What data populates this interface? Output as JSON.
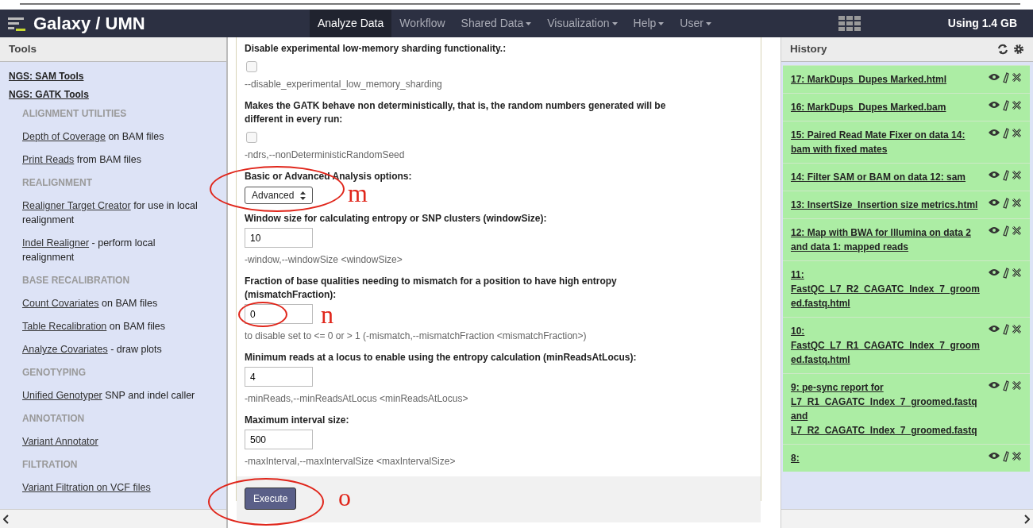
{
  "navbar": {
    "brand": "Galaxy / UMN",
    "tabs": [
      {
        "label": "Analyze Data",
        "selected": true,
        "dropdown": false
      },
      {
        "label": "Workflow",
        "selected": false,
        "dropdown": false
      },
      {
        "label": "Shared Data",
        "selected": false,
        "dropdown": true
      },
      {
        "label": "Visualization",
        "selected": false,
        "dropdown": true
      },
      {
        "label": "Help",
        "selected": false,
        "dropdown": true
      },
      {
        "label": "User",
        "selected": false,
        "dropdown": true
      }
    ],
    "usage": "Using 1.4 GB"
  },
  "tools": {
    "title": "Tools",
    "items": [
      {
        "kind": "category",
        "text": "NGS: SAM Tools"
      },
      {
        "kind": "category",
        "text": "NGS: GATK Tools"
      },
      {
        "kind": "section",
        "text": "ALIGNMENT UTILITIES"
      },
      {
        "kind": "tool",
        "link": "Depth of Coverage",
        "rest": "on BAM files"
      },
      {
        "kind": "tool",
        "link": "Print Reads",
        "rest": "from BAM files"
      },
      {
        "kind": "section",
        "text": "REALIGNMENT"
      },
      {
        "kind": "tool",
        "link": "Realigner Target Creator",
        "rest": "for use in local realignment"
      },
      {
        "kind": "tool",
        "link": "Indel Realigner",
        "rest": "- perform local realignment"
      },
      {
        "kind": "section",
        "text": "BASE RECALIBRATION"
      },
      {
        "kind": "tool",
        "link": "Count Covariates",
        "rest": "on BAM files"
      },
      {
        "kind": "tool",
        "link": "Table Recalibration",
        "rest": "on BAM files"
      },
      {
        "kind": "tool",
        "link": "Analyze Covariates",
        "rest": "- draw plots"
      },
      {
        "kind": "section",
        "text": "GENOTYPING"
      },
      {
        "kind": "tool",
        "link": "Unified Genotyper",
        "rest": "SNP and indel caller"
      },
      {
        "kind": "section",
        "text": "ANNOTATION"
      },
      {
        "kind": "tool",
        "link": "Variant Annotator"
      },
      {
        "kind": "section",
        "text": "FILTRATION"
      },
      {
        "kind": "tool",
        "link": "Variant Filtration on VCF files"
      }
    ]
  },
  "form": {
    "params": [
      {
        "kind": "checkbox",
        "label": "Disable experimental low-memory sharding functionality.:",
        "checked": false,
        "help": "--disable_experimental_low_memory_sharding"
      },
      {
        "kind": "checkbox",
        "label": "Makes the GATK behave non deterministically, that is, the random numbers generated will be different in every run:",
        "checked": false,
        "help": "-ndrs,--nonDeterministicRandomSeed"
      },
      {
        "kind": "select",
        "label": "Basic or Advanced Analysis options:",
        "value": "Advanced",
        "annotation": "m"
      },
      {
        "kind": "text",
        "label": "Window size for calculating entropy or SNP clusters (windowSize):",
        "value": "10",
        "help": "-window,--windowSize <windowSize>"
      },
      {
        "kind": "text",
        "label": "Fraction of base qualities needing to mismatch for a position to have high entropy (mismatchFraction):",
        "value": "0",
        "help": "to disable set to <= 0 or > 1 (-mismatch,--mismatchFraction <mismatchFraction>)",
        "annotation": "n"
      },
      {
        "kind": "text",
        "label": "Minimum reads at a locus to enable using the entropy calculation (minReadsAtLocus):",
        "value": "4",
        "help": "-minReads,--minReadsAtLocus <minReadsAtLocus>"
      },
      {
        "kind": "text",
        "label": "Maximum interval size:",
        "value": "500",
        "help": "-maxInterval,--maxIntervalSize <maxIntervalSize>"
      }
    ],
    "execute": {
      "label": "Execute",
      "annotation": "o"
    }
  },
  "history": {
    "title": "History",
    "items": [
      {
        "label": "17: MarkDups_Dupes Marked.html"
      },
      {
        "label": "16: MarkDups_Dupes Marked.bam"
      },
      {
        "label": "15: Paired Read Mate Fixer on data 14: bam with fixed mates"
      },
      {
        "label": "14: Filter SAM or BAM on data 12: sam"
      },
      {
        "label": "13: InsertSize_Insertion size metrics.html"
      },
      {
        "label": "12: Map with BWA for Illumina on data 2 and data 1: mapped reads"
      },
      {
        "label": "11: FastQC_L7_R2_CAGATC_Index_7_groomed.fastq.html"
      },
      {
        "label": "10: FastQC_L7_R1_CAGATC_Index_7_groomed.fastq.html"
      },
      {
        "label": "9: pe-sync report for L7_R1_CAGATC_Index_7_groomed.fastq and L7_R2_CAGATC_Index_7_groomed.fastq"
      },
      {
        "label": "8:"
      }
    ]
  }
}
